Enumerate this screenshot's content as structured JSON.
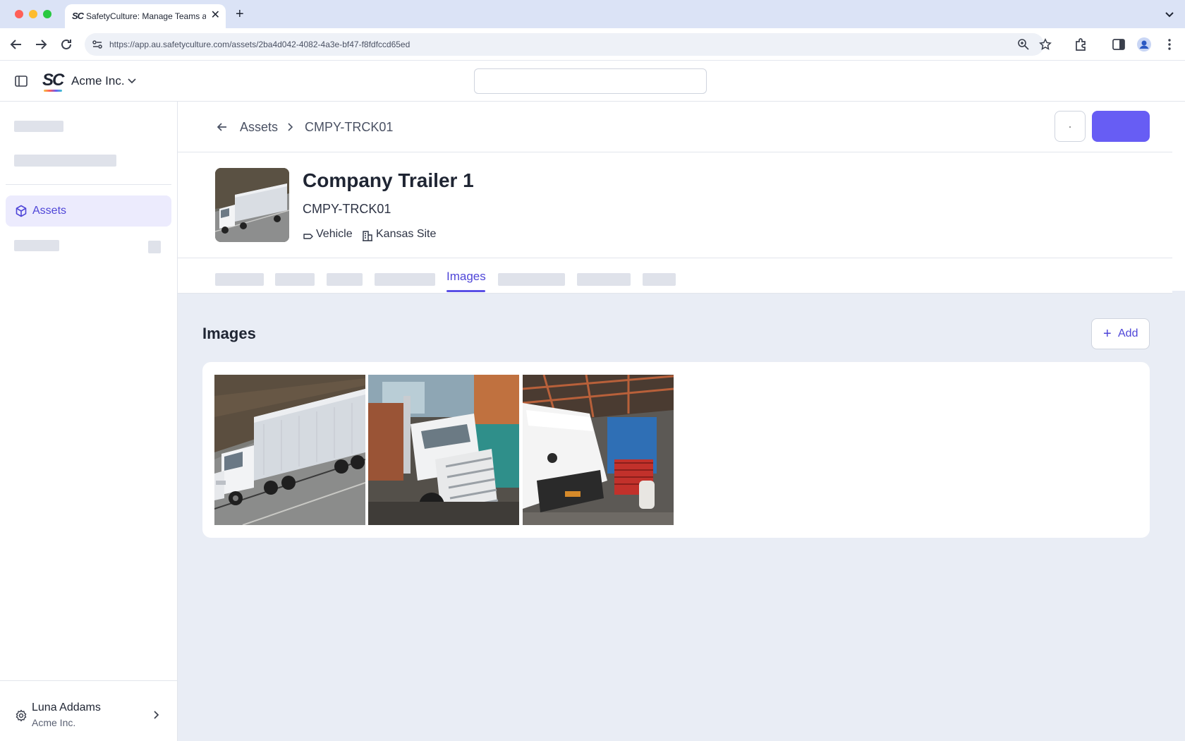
{
  "browser": {
    "tab_title": "SafetyCulture: Manage Teams and...",
    "tab_favicon": "SC",
    "url": "https://app.au.safetyculture.com/assets/2ba4d042-4082-4a3e-bf47-f8fdfccd65ed"
  },
  "app": {
    "logo": "SC",
    "org_name": "Acme Inc.",
    "search_placeholder": ""
  },
  "sidebar": {
    "active_item": "Assets",
    "user": {
      "name": "Luna Addams",
      "org": "Acme Inc."
    }
  },
  "breadcrumb": {
    "parent": "Assets",
    "current": "CMPY-TRCK01"
  },
  "asset": {
    "title": "Company Trailer 1",
    "code": "CMPY-TRCK01",
    "type": "Vehicle",
    "site": "Kansas Site"
  },
  "tabs": {
    "active": "Images"
  },
  "images_section": {
    "title": "Images",
    "add_label": "Add",
    "photos": [
      "truck-on-highway",
      "truck-in-workshop",
      "truck-hood-open-garage"
    ]
  },
  "colors": {
    "accent": "#675df4",
    "accent_text": "#4f46d8",
    "content_bg": "#e9edf5"
  }
}
